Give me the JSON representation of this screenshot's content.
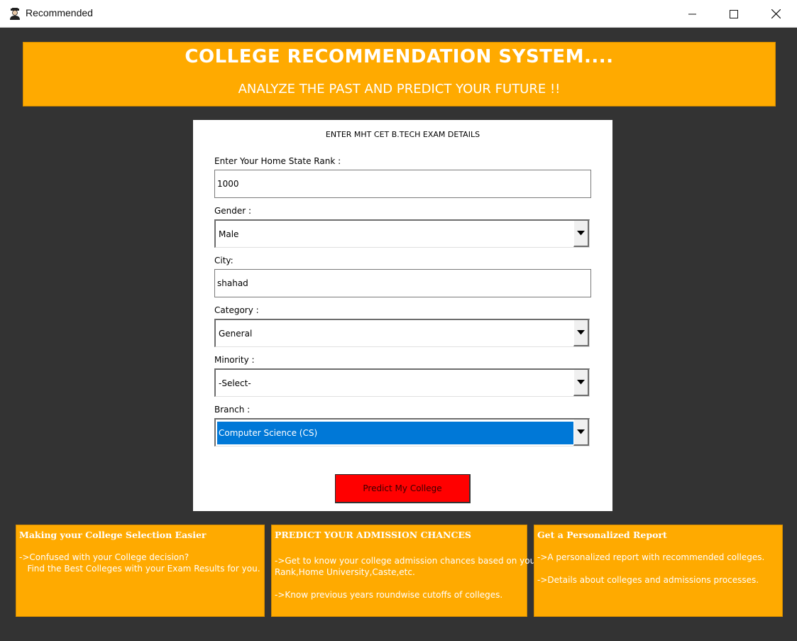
{
  "window": {
    "title": "Recommended",
    "icon": "user-avatar-icon"
  },
  "banner": {
    "title": "COLLEGE RECOMMENDATION SYSTEM....",
    "subtitle": "ANALYZE THE PAST AND PREDICT YOUR FUTURE !!"
  },
  "form": {
    "heading": "ENTER MHT CET B.TECH EXAM DETAILS",
    "rank_label": "Enter Your Home State Rank :",
    "rank_value": "1000",
    "gender_label": "Gender :",
    "gender_value": "Male",
    "city_label": "City:",
    "city_value": "shahad",
    "category_label": "Category :",
    "category_value": "General",
    "minority_label": "Minority :",
    "minority_value": "-Select-",
    "branch_label": "Branch :",
    "branch_value": "Computer Science (CS)",
    "submit_label": "Predict My College"
  },
  "cards": [
    {
      "title": "Making your College Selection Easier",
      "lines": [
        "->Confused with your College decision?",
        "   Find the Best Colleges with your Exam Results for you."
      ]
    },
    {
      "title": "PREDICT YOUR ADMISSION CHANCES",
      "lines": [
        "->Get to know your college admission chances based on your",
        "Rank,Home University,Caste,etc.",
        "->Know previous years roundwise cutoffs of colleges."
      ]
    },
    {
      "title": "Get a Personalized Report",
      "lines": [
        "->A personalized report with recommended colleges.",
        "->Details about colleges and admissions processes."
      ]
    }
  ],
  "colors": {
    "accent": "#ffaa00",
    "background": "#333333",
    "button": "#ff0000",
    "selection": "#0078d7"
  }
}
